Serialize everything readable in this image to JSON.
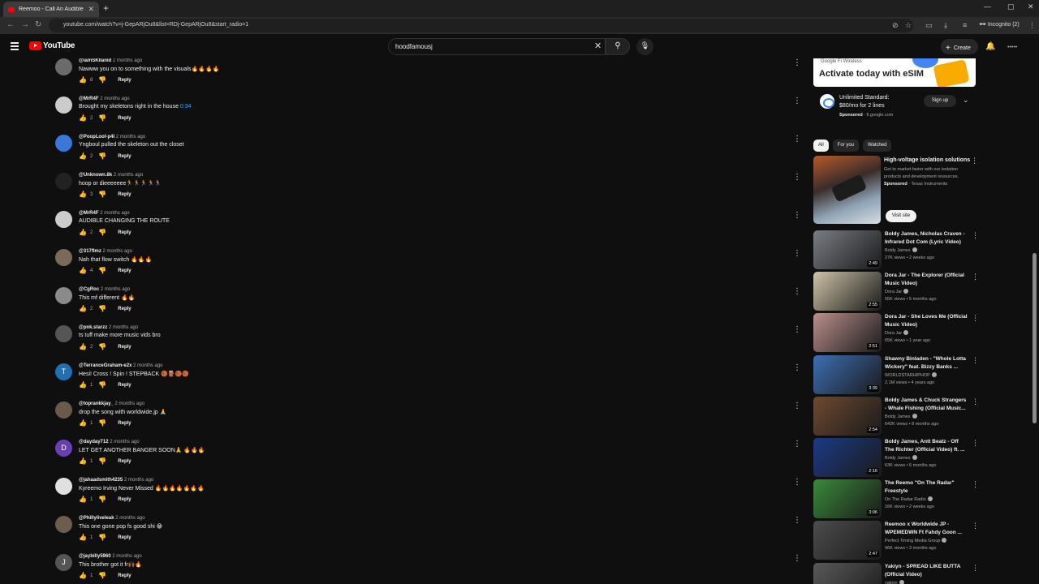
{
  "browser": {
    "tab_title": "Reemoo - Call An Audible (Offi",
    "url": "youtube.com/watch?v=j-GepARjOu8&list=RDj-GepARjOu8&start_radio=1",
    "profile": "Incognito (2)"
  },
  "header": {
    "logo_text": "YouTube",
    "search_value": "hoodfamousj",
    "create_label": "Create"
  },
  "comments": [
    {
      "user": "@iamSKIlanid",
      "time": "2 months ago",
      "text": "Nawww you on to something with the visuals🔥🔥🔥🔥",
      "likes": "8",
      "avatar_letter": ""
    },
    {
      "user": "@MrR4F",
      "time": "2 months ago",
      "text": "Brought my skeletons right in the house",
      "timestamp": "0:34",
      "likes": "2",
      "avatar_letter": ""
    },
    {
      "user": "@PoopLool-p4l",
      "time": "2 months ago",
      "text": "Yngboul pulled the skeleton out the closet",
      "likes": "2",
      "avatar_letter": ""
    },
    {
      "user": "@Unknown.8k",
      "time": "2 months ago",
      "text": "hoop or dieeeeeee🏃🏃🏃🏃🏃",
      "likes": "3",
      "avatar_letter": ""
    },
    {
      "user": "@MrR4F",
      "time": "2 months ago",
      "text": "AUDIBLE CHANGING THE ROUTE",
      "likes": "2",
      "avatar_letter": ""
    },
    {
      "user": "@317flmz",
      "time": "2 months ago",
      "text": "Nah that flow switch 🔥🔥🔥",
      "likes": "4",
      "avatar_letter": ""
    },
    {
      "user": "@CgRoc",
      "time": "2 months ago",
      "text": "This mf different 🔥🔥",
      "likes": "2",
      "avatar_letter": ""
    },
    {
      "user": "@pnk.starzz",
      "time": "2 months ago",
      "text": "ts tuff make more music vids bro",
      "likes": "2",
      "avatar_letter": ""
    },
    {
      "user": "@TerranceGraham-e2x",
      "time": "2 months ago",
      "text": "Hesi! Cross ! Spin ! STEPBACK 🏀🪵🏀🏀",
      "likes": "1",
      "avatar_letter": "T"
    },
    {
      "user": "@toprankkjay_",
      "time": "2 months ago",
      "text": "drop the song with worldwide.jp 🙏",
      "likes": "1",
      "avatar_letter": ""
    },
    {
      "user": "@dayday712",
      "time": "2 months ago",
      "text": "LET GET ANOTHER BANGER SOON🙏 🔥🔥🔥",
      "likes": "1",
      "avatar_letter": "D"
    },
    {
      "user": "@jahaadsmith4235",
      "time": "2 months ago",
      "text": "Kyreemo Irving Never Missed 🔥🔥🔥🔥🔥🔥🔥",
      "likes": "1",
      "avatar_letter": ""
    },
    {
      "user": "@Phillyliveleak",
      "time": "2 months ago",
      "text": "This one gone pop fs good shi 😁",
      "likes": "1",
      "avatar_letter": ""
    },
    {
      "user": "@jaybilly5960",
      "time": "2 months ago",
      "text": "This brother got it fr🙌🏾🔥",
      "likes": "1",
      "avatar_letter": "J"
    }
  ],
  "comment_reply_label": "Reply",
  "sidebar": {
    "ad_banner": {
      "brand_line": "Google Fi Wireless",
      "headline": "Activate today with eSIM"
    },
    "ad_card": {
      "title_line1": "Unlimited Standard:",
      "title_line2": "$80/mo for 2 lines",
      "sponsored": "Sponsored",
      "domain": "fi.google.com",
      "cta": "Sign up"
    },
    "chips": [
      "All",
      "For you",
      "Watched"
    ],
    "sponsored_video": {
      "title": "High-voltage isolation solutions",
      "description": "Get to market faster with our isolation products and development resources.",
      "sponsored": "Sponsored",
      "advertiser": "Texas Instruments",
      "cta": "Visit site"
    },
    "recommendations": [
      {
        "title": "Boldy James, Nicholas Craven - Infrared Dot Com (Lyric Video)",
        "channel": "Boldy James",
        "meta": "27K views • 2 weeks ago",
        "duration": "2:49",
        "thumb": "#7a7d85"
      },
      {
        "title": "Dora Jar - The Explorer (Official Music Video)",
        "channel": "Dora Jar",
        "meta": "55K views • 5 months ago",
        "duration": "2:55",
        "thumb": "#cfc3a8"
      },
      {
        "title": "Dora Jar - She Loves Me (Official Music Video)",
        "channel": "Dora Jar",
        "meta": "65K views • 1 year ago",
        "duration": "2:51",
        "thumb": "#b98f8c"
      },
      {
        "title": "Shawny Binladen - \"Whole Lotta Wickery\" feat. Bizzy Banks ...",
        "channel": "WORLDSTARHIPHOP",
        "meta": "2.1M views • 4 years ago",
        "duration": "3:39",
        "thumb": "#3e6fb5"
      },
      {
        "title": "Boldy James & Chuck Strangers - Whale Fishing (Official Music...",
        "channel": "Boldy James",
        "meta": "642K views • 8 months ago",
        "duration": "2:54",
        "thumb": "#6d4a32"
      },
      {
        "title": "Boldy James, Antt Beatz - Off The Richter (Official Video) ft. ...",
        "channel": "Boldy James",
        "meta": "63K views • 6 months ago",
        "duration": "2:16",
        "thumb": "#1b3a86"
      },
      {
        "title": "The Reemo \"On The Radar\" Freestyle",
        "channel": "On The Radar Radio",
        "meta": "16K views • 2 weeks ago",
        "duration": "3:06",
        "thumb": "#3a8a3a"
      },
      {
        "title": "Reemoo x Worldwide JP - WPEMEDWN Ft Fahdy Goon ...",
        "channel": "Perfect Timing Media Group",
        "meta": "96K views • 3 months ago",
        "duration": "2:47",
        "thumb": "#4d4d4d"
      },
      {
        "title": "Yakiyn - SPREAD LIKE BUTTA (Official Video)",
        "channel": "yakiyn",
        "meta": "",
        "duration": "",
        "thumb": "#5a5a5a"
      }
    ]
  },
  "colors": {
    "background": "#0f0f0f",
    "text": "#f1f1f1",
    "secondary": "#aaaaaa",
    "link": "#3ea6ff",
    "brand": "#ff0000"
  },
  "icons": [
    "menu-icon",
    "youtube-logo-icon",
    "search-icon",
    "clear-icon",
    "mic-icon",
    "plus-icon",
    "bell-icon",
    "like-icon",
    "dislike-icon",
    "more-vert-icon",
    "verified-icon",
    "chevron-down-icon"
  ]
}
